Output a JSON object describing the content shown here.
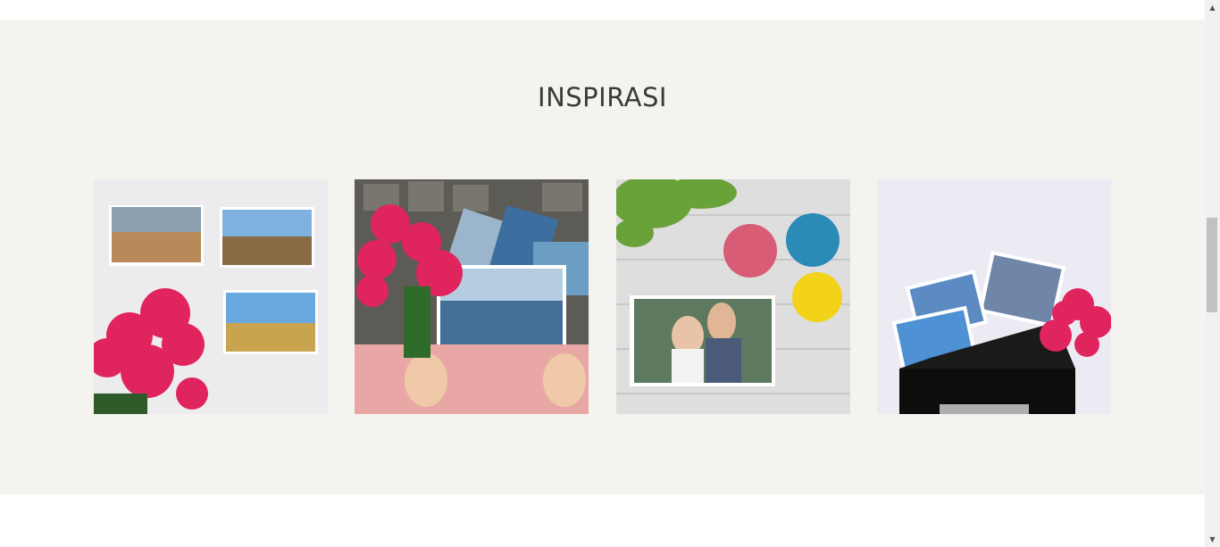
{
  "inspiration": {
    "title": "INSPIRASI",
    "images": [
      {
        "name": "photo-prints-with-pink-flowers",
        "icon": "photo-image"
      },
      {
        "name": "hands-holding-prints-and-flowers",
        "icon": "photo-image"
      },
      {
        "name": "couple-print-with-yarn",
        "icon": "photo-image"
      },
      {
        "name": "prints-in-black-box",
        "icon": "photo-image"
      }
    ]
  },
  "colors": {
    "section_bg": "#f4f3f0",
    "title": "#3a3a3a",
    "flower_pink": "#e0245e"
  },
  "scrollbar": {
    "up_icon": "▲",
    "down_icon": "▼"
  }
}
